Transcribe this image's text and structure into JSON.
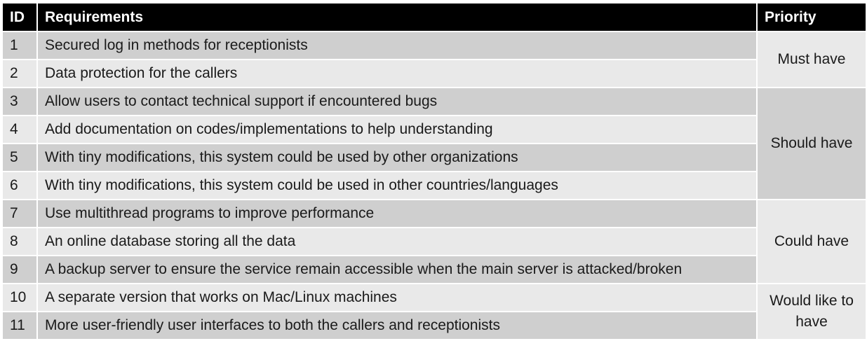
{
  "table": {
    "headers": {
      "id": "ID",
      "requirements": "Requirements",
      "priority": "Priority"
    },
    "rows": [
      {
        "id": "1",
        "requirement": "Secured log in methods for receptionists"
      },
      {
        "id": "2",
        "requirement": "Data protection for the callers"
      },
      {
        "id": "3",
        "requirement": "Allow users to contact technical support if encountered bugs"
      },
      {
        "id": "4",
        "requirement": "Add documentation on codes/implementations to help understanding"
      },
      {
        "id": "5",
        "requirement": "With tiny modifications, this system could be used by other organizations"
      },
      {
        "id": "6",
        "requirement": "With tiny modifications, this system could be used in other countries/languages"
      },
      {
        "id": "7",
        "requirement": "Use multithread programs to improve performance"
      },
      {
        "id": "8",
        "requirement": "An online database storing all the data"
      },
      {
        "id": "9",
        "requirement": "A backup server to ensure the service remain accessible when the main server is attacked/broken"
      },
      {
        "id": "10",
        "requirement": "A separate version that works on Mac/Linux machines"
      },
      {
        "id": "11",
        "requirement": "More user-friendly user interfaces to both the callers and receptionists"
      }
    ],
    "priority_groups": [
      {
        "label": "Must have"
      },
      {
        "label": "Should have"
      },
      {
        "label": "Could have"
      },
      {
        "label": "Would like to have"
      }
    ]
  },
  "colors": {
    "header_bg": "#000000",
    "header_text": "#ffffff",
    "row_dark": "#cfcfcf",
    "row_light": "#e9e9e9"
  }
}
